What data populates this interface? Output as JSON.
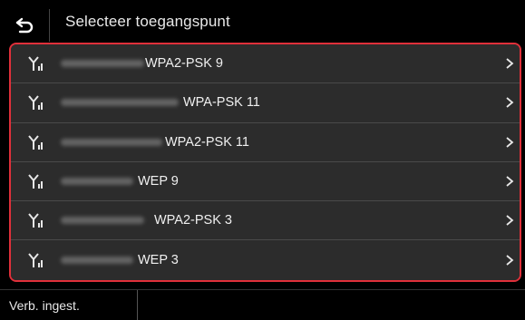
{
  "header": {
    "title": "Selecteer toegangspunt",
    "back_icon": "back-arrow-icon"
  },
  "networks": [
    {
      "security": "WPA2-PSK 9"
    },
    {
      "security": "WPA-PSK 11"
    },
    {
      "security": "WPA2-PSK 11"
    },
    {
      "security": "WEP 9"
    },
    {
      "security": "WPA2-PSK 3"
    },
    {
      "security": "WEP 3"
    }
  ],
  "footer": {
    "connection_settings_label": "Verb. ingest."
  },
  "colors": {
    "highlight_border": "#e0303a",
    "row_background": "#2c2c2c",
    "background": "#000000"
  }
}
